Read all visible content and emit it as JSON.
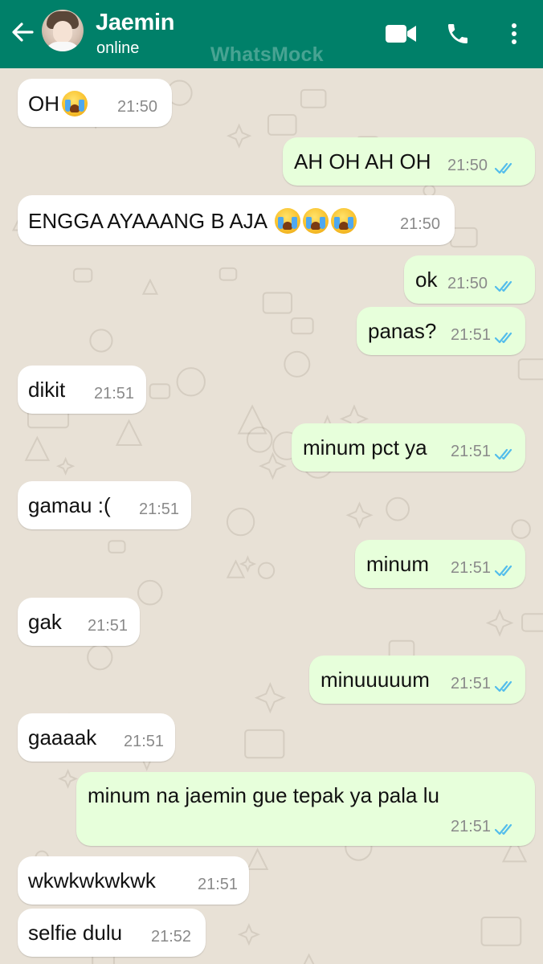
{
  "header": {
    "contact_name": "Jaemin",
    "contact_status": "online",
    "watermark": "WhatsMock",
    "bar_color": "#008069",
    "icons": [
      "back-arrow-icon",
      "video-call-icon",
      "phone-call-icon",
      "more-options-icon"
    ]
  },
  "chat": {
    "wallpaper_color": "#e8e1d6",
    "incoming_bubble_color": "#ffffff",
    "outgoing_bubble_color": "#e7ffdb",
    "read_tick_color": "#53bdeb",
    "messages": [
      {
        "direction": "in",
        "text": "OH",
        "emoji_count": 1,
        "time": "21:50"
      },
      {
        "direction": "out",
        "text": "AH OH AH OH",
        "time": "21:50",
        "status": "read"
      },
      {
        "direction": "in",
        "text": "ENGGA AYAAANG B AJA",
        "emoji_count": 3,
        "time": "21:50"
      },
      {
        "direction": "out",
        "text": "ok",
        "time": "21:50",
        "status": "read"
      },
      {
        "direction": "out",
        "text": "panas?",
        "time": "21:51",
        "status": "read"
      },
      {
        "direction": "in",
        "text": "dikit",
        "time": "21:51"
      },
      {
        "direction": "out",
        "text": "minum pct ya",
        "time": "21:51",
        "status": "read"
      },
      {
        "direction": "in",
        "text": "gamau :(",
        "time": "21:51"
      },
      {
        "direction": "out",
        "text": "minum",
        "time": "21:51",
        "status": "read"
      },
      {
        "direction": "in",
        "text": "gak",
        "time": "21:51"
      },
      {
        "direction": "out",
        "text": "minuuuuum",
        "time": "21:51",
        "status": "read"
      },
      {
        "direction": "in",
        "text": "gaaaak",
        "time": "21:51"
      },
      {
        "direction": "out",
        "text": "minum na jaemin gue tepak ya pala lu",
        "time": "21:51",
        "status": "read"
      },
      {
        "direction": "in",
        "text": "wkwkwkwkwk",
        "time": "21:51"
      },
      {
        "direction": "in",
        "text": "selfie dulu",
        "time": "21:52"
      }
    ]
  }
}
